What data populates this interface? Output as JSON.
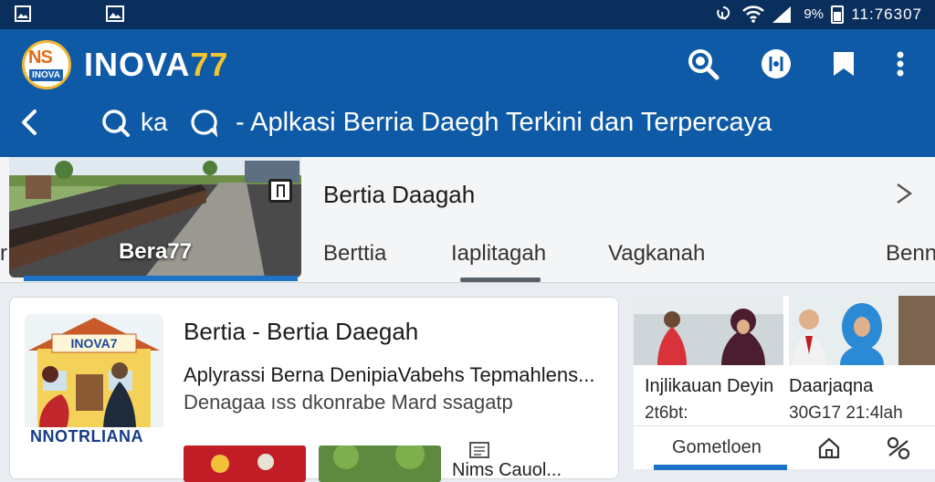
{
  "status": {
    "battery_percent": "9%",
    "time": "11:76307"
  },
  "app": {
    "brand_name": "INOVA",
    "brand_suffix": "77",
    "logo_letters": "NS",
    "logo_sub": "INOVA"
  },
  "subheader": {
    "quick_label": "ka",
    "title": "- Aplkasi Berria Daegh Terkini dan Terpercaya"
  },
  "panel": {
    "hero_label": "Bera77",
    "title": "Bertia Daagah",
    "tabs": [
      {
        "label": "Berttia"
      },
      {
        "label": "Iaplitagah"
      },
      {
        "label": "Vagkanah"
      },
      {
        "label": "Benn"
      }
    ],
    "left_edge": "r"
  },
  "card": {
    "title": "Bertia - Bertia Daegah",
    "line1": "Aplyrassi Berna DenipiaVabehs Tepmahlens...",
    "line2": "Denagaa ıss dkonrabe Mard ssagatp",
    "thumb_sign": "INOVA7",
    "thumb_caption": "NNOTRLIANA",
    "mini_label": "Nims Cauol..."
  },
  "side": {
    "items": [
      {
        "caption": "Injlikauan Deyin",
        "date": "2t6bt:"
      },
      {
        "caption": "Daarjaqna",
        "date": "30G17 21:4lah"
      }
    ],
    "bottom_label": "Gometloen"
  },
  "colors": {
    "appbar": "#0f5aa6",
    "statusbar": "#0b2f5c",
    "brand_accent": "#f2c430",
    "active": "#1e72c8"
  }
}
